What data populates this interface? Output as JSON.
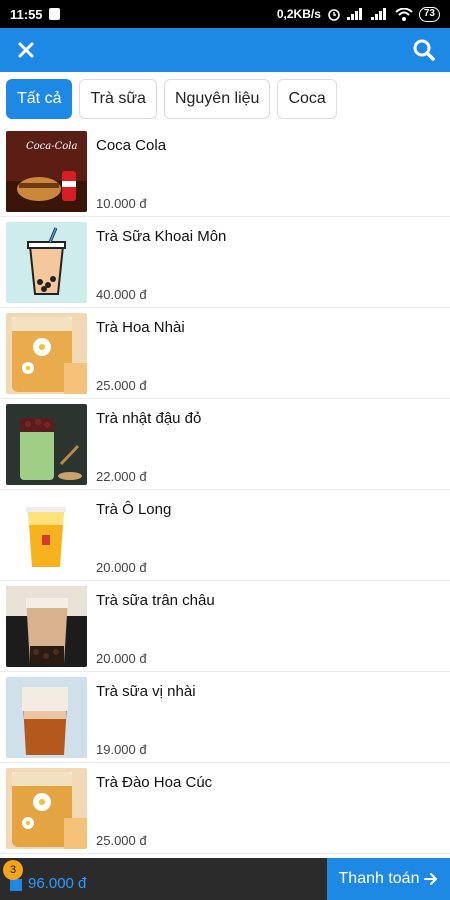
{
  "status_bar": {
    "time": "11:55",
    "network_speed": "0,2KB/s",
    "battery": "73"
  },
  "app_bar": {
    "close_icon": "close-icon",
    "search_icon": "search-icon"
  },
  "categories": [
    {
      "label": "Tất cả",
      "active": true
    },
    {
      "label": "Trà sữa",
      "active": false
    },
    {
      "label": "Nguyên liệu",
      "active": false
    },
    {
      "label": "Coca",
      "active": false
    }
  ],
  "products": [
    {
      "name": "Coca Cola",
      "price": "10.000 đ"
    },
    {
      "name": "Trà Sữa Khoai Môn",
      "price": "40.000 đ"
    },
    {
      "name": "Trà Hoa Nhài",
      "price": "25.000 đ"
    },
    {
      "name": "Trà nhật đậu đỏ",
      "price": "22.000 đ"
    },
    {
      "name": "Trà Ô Long",
      "price": "20.000 đ"
    },
    {
      "name": "Trà sữa trân châu",
      "price": "20.000 đ"
    },
    {
      "name": "Trà sữa vị nhài",
      "price": "19.000 đ"
    },
    {
      "name": "Trà Đào Hoa Cúc",
      "price": "25.000 đ"
    }
  ],
  "cart": {
    "count": "3",
    "total": "96.000 đ"
  },
  "checkout": {
    "label": "Thanh toán"
  },
  "colors": {
    "primary": "#1e88e5",
    "bottom_bar": "#2b2b2b",
    "badge": "#f7a41d"
  }
}
